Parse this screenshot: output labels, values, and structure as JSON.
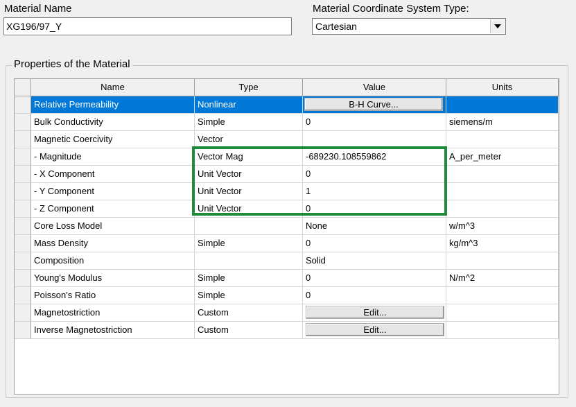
{
  "material": {
    "name_label": "Material Name",
    "name_value": "XG196/97_Y"
  },
  "coordinate_system": {
    "label": "Material Coordinate System Type:",
    "selected": "Cartesian"
  },
  "properties": {
    "group_title": "Properties of the Material",
    "columns": [
      "Name",
      "Type",
      "Value",
      "Units"
    ],
    "rows": [
      {
        "name": "Relative Permeability",
        "type": "Nonlinear",
        "value": "B-H Curve...",
        "units": ""
      },
      {
        "name": "Bulk Conductivity",
        "type": "Simple",
        "value": "0",
        "units": "siemens/m"
      },
      {
        "name": "Magnetic Coercivity",
        "type": "Vector",
        "value": "",
        "units": ""
      },
      {
        "name": "- Magnitude",
        "type": "Vector Mag",
        "value": "-689230.108559862",
        "units": "A_per_meter"
      },
      {
        "name": "- X Component",
        "type": "Unit Vector",
        "value": "0",
        "units": ""
      },
      {
        "name": "- Y Component",
        "type": "Unit Vector",
        "value": "1",
        "units": ""
      },
      {
        "name": "- Z Component",
        "type": "Unit Vector",
        "value": "0",
        "units": ""
      },
      {
        "name": "Core Loss Model",
        "type": "",
        "value": "None",
        "units": "w/m^3"
      },
      {
        "name": "Mass Density",
        "type": "Simple",
        "value": "0",
        "units": "kg/m^3"
      },
      {
        "name": "Composition",
        "type": "",
        "value": "Solid",
        "units": ""
      },
      {
        "name": "Young's Modulus",
        "type": "Simple",
        "value": "0",
        "units": "N/m^2"
      },
      {
        "name": "Poisson's Ratio",
        "type": "Simple",
        "value": "0",
        "units": ""
      },
      {
        "name": "Magnetostriction",
        "type": "Custom",
        "value": "Edit...",
        "units": ""
      },
      {
        "name": "Inverse Magnetostriction",
        "type": "Custom",
        "value": "Edit...",
        "units": ""
      }
    ]
  },
  "colors": {
    "selection": "#0078d7",
    "highlight_box": "#1e8c3a"
  },
  "icons": {
    "dropdown": "chevron-down-icon"
  }
}
